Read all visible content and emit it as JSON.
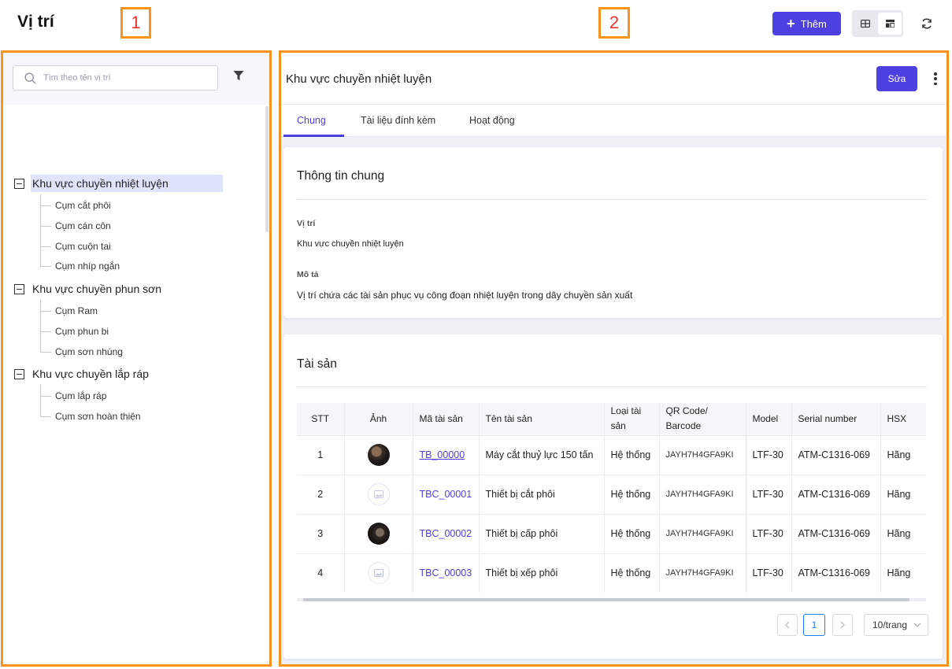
{
  "page": {
    "title": "Vị trí"
  },
  "annotations": {
    "left_number": "1",
    "right_number": "2"
  },
  "header": {
    "add_label": "Thêm",
    "colors": {
      "accent": "#4d3fe0",
      "annotation_border": "#f7931e",
      "annotation_text": "#e5342b"
    }
  },
  "sidebar": {
    "search_placeholder": "Tìm theo tên vị trí",
    "groups": [
      {
        "label": "Khu vực chuyền nhiệt luyện",
        "selected": true,
        "children": [
          "Cụm cắt phôi",
          "Cụm cán côn",
          "Cụm cuộn tai",
          "Cụm nhíp ngắn"
        ]
      },
      {
        "label": "Khu vực chuyền phun sơn",
        "selected": false,
        "children": [
          "Cụm Ram",
          "Cụm phun bi",
          "Cụm sơn nhúng"
        ]
      },
      {
        "label": "Khu vực chuyền lắp ráp",
        "selected": false,
        "children": [
          "Cụm lắp ráp",
          "Cụm sơn hoàn thiện"
        ]
      }
    ]
  },
  "detail": {
    "title": "Khu vực chuyền nhiệt luyện",
    "edit_label": "Sửa",
    "tabs": [
      {
        "label": "Chung",
        "active": true
      },
      {
        "label": "Tài liệu đính kèm",
        "active": false
      },
      {
        "label": "Hoạt động",
        "active": false
      }
    ],
    "general": {
      "title": "Thông tin chung",
      "location_label": "Vị trí",
      "location_value": "Khu vực chuyền nhiệt luyện",
      "description_label": "Mô tả",
      "description_value": "Vị trí chứa các tài sản phục vụ công đoạn nhiệt luyện trong dây chuyền sản xuất"
    },
    "assets": {
      "title": "Tài sản",
      "columns": [
        "STT",
        "Ảnh",
        "Mã tài sản",
        "Tên tài sản",
        "Loại tài sản",
        "QR Code/ Barcode",
        "Model",
        "Serial number",
        "HSX"
      ],
      "rows": [
        {
          "stt": "1",
          "image": "photo",
          "code": "TB_00000",
          "name": "Máy cắt thuỷ lực 150 tấn",
          "type": "Hệ thống",
          "qr": "JAYH7H4GFA9KI",
          "model": "LTF-30",
          "serial": "ATM-C1316-069",
          "hsx": "Hãng"
        },
        {
          "stt": "2",
          "image": "placeholder",
          "code": "TBC_00001",
          "name": "Thiết bị cắt phôi",
          "type": "Hệ thống",
          "qr": "JAYH7H4GFA9KI",
          "model": "LTF-30",
          "serial": "ATM-C1316-069",
          "hsx": "Hãng"
        },
        {
          "stt": "3",
          "image": "photo",
          "code": "TBC_00002",
          "name": "Thiết bị cấp phôi",
          "type": "Hệ thống",
          "qr": "JAYH7H4GFA9KI",
          "model": "LTF-30",
          "serial": "ATM-C1316-069",
          "hsx": "Hãng"
        },
        {
          "stt": "4",
          "image": "placeholder",
          "code": "TBC_00003",
          "name": "Thiết bị xếp phôi",
          "type": "Hệ thống",
          "qr": "JAYH7H4GFA9KI",
          "model": "LTF-30",
          "serial": "ATM-C1316-069",
          "hsx": "Hãng"
        }
      ],
      "pagination": {
        "current_page": "1",
        "page_size": "10/trang"
      }
    }
  }
}
